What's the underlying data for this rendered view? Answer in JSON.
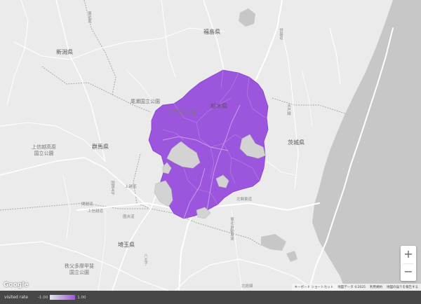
{
  "map": {
    "prefecture_labels": {
      "fukushima": "福島県",
      "niigata": "新潟県",
      "tochigi": "栃木県",
      "gunma": "群馬県",
      "ibaraki": "茨城県",
      "saitama": "埼玉県"
    },
    "park_labels": {
      "oze": "尾瀬国立公園",
      "nikko": "日光国立公園",
      "joshinetsu": "上信越高原\n国立公園",
      "chichibu": "秩父多摩甲斐\n国立公園"
    },
    "road_labels": {
      "joban": "常磐道",
      "tohoku": "東北道",
      "kitakanto": "北関東道",
      "joetsu": "上越道",
      "kanetsu": "関越道",
      "tohoku2": "東北自動車道",
      "kan_etsu_road": "上信越道",
      "ken_o": "圏央道",
      "r4": "国道4号",
      "mito": "水戸線",
      "hachioji": "八王子",
      "kita": "北総線"
    },
    "colors": {
      "visited": "#9c55dd",
      "visited_border": "#8a3fd0",
      "unvisited": "#d3d3d3",
      "sea": "#c7c7c7",
      "land": "#ebebeb"
    },
    "zoom": {
      "in_label": "+",
      "out_label": "−"
    },
    "logo": "Google",
    "attribution": {
      "shortcuts": "キーボード ショートカット",
      "map_data": "地図データ ©2025",
      "terms": "利用規約",
      "report": "地図の誤りを報告する"
    }
  },
  "legend": {
    "title": "visited rate",
    "min": "-1.00",
    "max": "1.00",
    "min_color": "#e6e6e6",
    "max_color": "#9c55dd"
  }
}
